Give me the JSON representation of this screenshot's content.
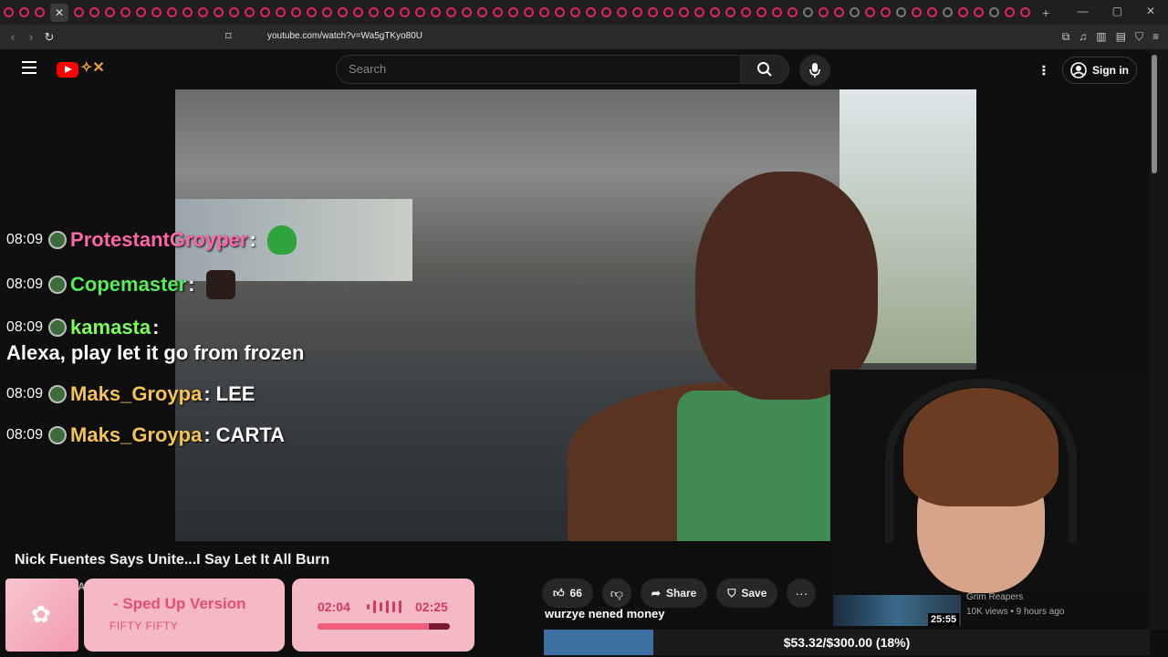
{
  "browser": {
    "url": "youtube.com/watch?v=Wa5gTKyo80U",
    "new_tab": "+"
  },
  "youtube": {
    "search_placeholder": "Search",
    "signin_label": "Sign in"
  },
  "chat": [
    {
      "time": "08:09",
      "user": "ProtestantGroyper",
      "color": "#ff66aa",
      "text": "",
      "emote": "frog"
    },
    {
      "time": "08:09",
      "user": "Copemaster",
      "color": "#55ee55",
      "text": "",
      "emote": "pic"
    },
    {
      "time": "08:09",
      "user": "kamasta",
      "color": "#7dff5a",
      "text": "Alexa, play let it go from frozen",
      "emote": ""
    },
    {
      "time": "08:09",
      "user": "Maks_Groypa",
      "color": "#f5c451",
      "text": "LEE",
      "emote": ""
    },
    {
      "time": "08:09",
      "user": "Maks_Groypa",
      "color": "#f5c451",
      "text": "CARTA",
      "emote": ""
    }
  ],
  "video": {
    "title": "Nick Fuentes Says Unite...I Say Let It All Burn",
    "likes": "66",
    "share_label": "Share",
    "save_label": "Save",
    "comment": "wurzye nened money",
    "channel_initial": "A"
  },
  "now_playing": {
    "title": "- Sped Up Version",
    "artist": "FIFTY FIFTY",
    "elapsed": "02:04",
    "total": "02:25",
    "progress": 0.84
  },
  "recommendation": {
    "title": "Grim Reapers",
    "meta": "10K views • 9 hours ago",
    "duration": "25:55"
  },
  "goal": {
    "text": "$53.32/$300.00 (18%)",
    "fraction": 0.18
  }
}
